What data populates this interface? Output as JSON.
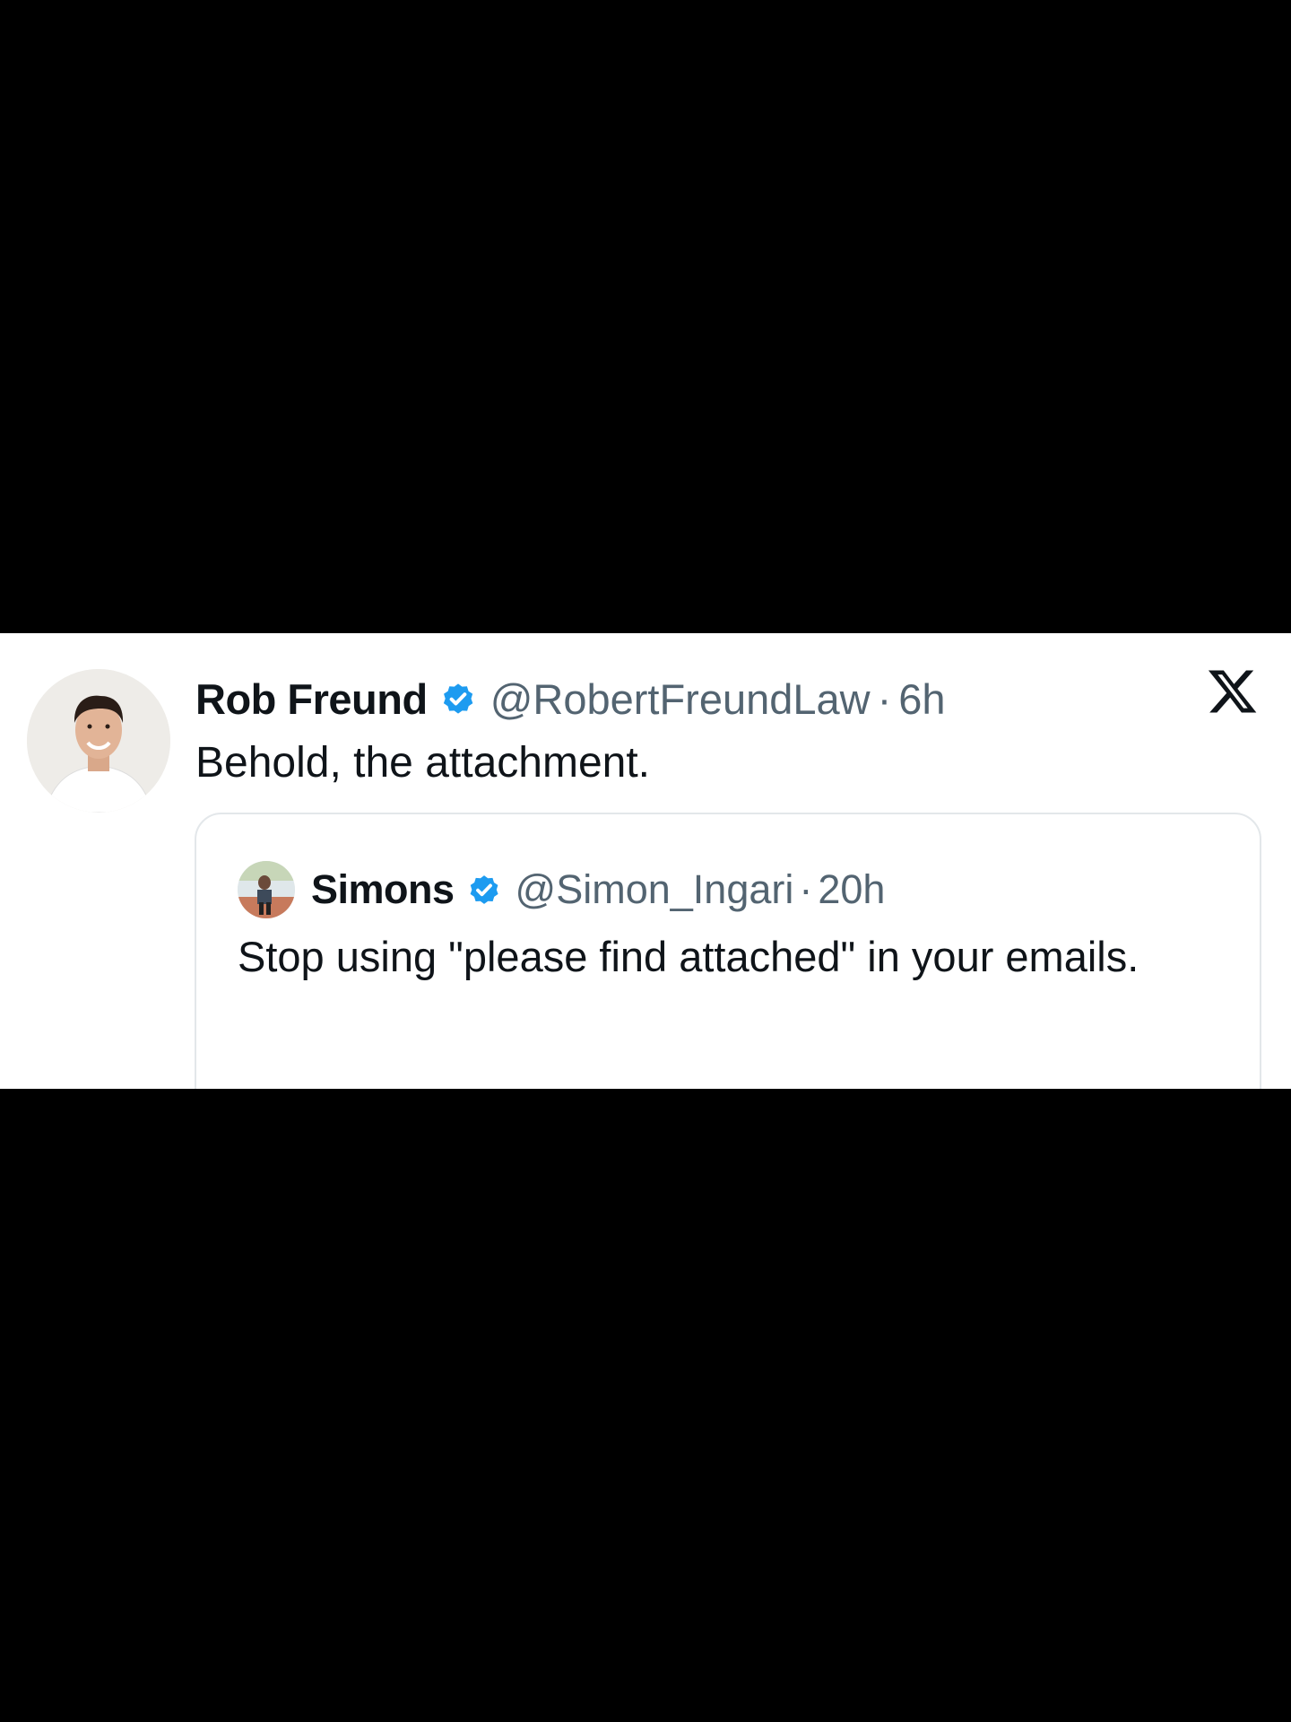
{
  "tweet": {
    "author_name": "Rob Freund",
    "author_handle": "@RobertFreundLaw",
    "separator": "·",
    "time": "6h",
    "text": "Behold, the attachment."
  },
  "quoted_tweet": {
    "author_name": "Simons",
    "author_handle": "@Simon_Ingari",
    "separator": "·",
    "time": "20h",
    "text": "Stop using \"please find attached\" in your emails."
  },
  "icons": {
    "verified": "verified-badge-icon",
    "platform_logo": "x-logo-icon"
  },
  "colors": {
    "background": "#000000",
    "card": "#ffffff",
    "text_primary": "#0f1419",
    "text_secondary": "#536471",
    "verified_blue": "#1d9bf0",
    "border": "#e3e7ea"
  }
}
